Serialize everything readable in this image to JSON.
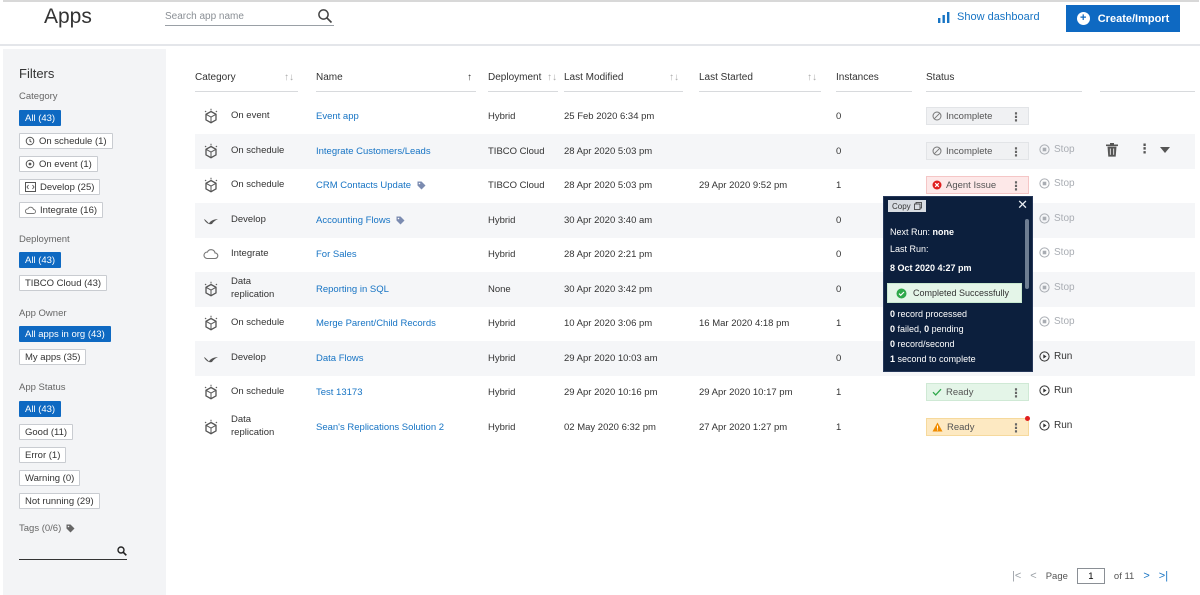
{
  "header": {
    "title": "Apps",
    "search_placeholder": "Search app name",
    "dashboard_link": "Show dashboard",
    "create_button": "Create/Import"
  },
  "sidebar": {
    "title": "Filters",
    "category_label": "Category",
    "category_chips": [
      "All (43)",
      "On schedule (1)",
      "On event (1)",
      "Develop (25)",
      "Integrate (16)"
    ],
    "deployment_label": "Deployment",
    "deployment_chips": [
      "All (43)",
      "TIBCO Cloud (43)"
    ],
    "owner_label": "App Owner",
    "owner_chips": [
      "All apps in org (43)",
      "My apps (35)"
    ],
    "status_label": "App Status",
    "status_chips": [
      "All (43)",
      "Good (11)",
      "Error (1)",
      "Warning (0)",
      "Not running (29)"
    ],
    "tags_label": "Tags (0/6)"
  },
  "table": {
    "columns": [
      "Category",
      "Name",
      "Deployment",
      "Last Modified",
      "Last Started",
      "Instances",
      "Status"
    ],
    "rows": [
      {
        "category": "On event",
        "name": "Event app",
        "deployment": "Hybrid",
        "modified": "25 Feb 2020 6:34 pm",
        "started": "",
        "instances": "0",
        "status": "Incomplete",
        "action": ""
      },
      {
        "category": "On schedule",
        "name": "Integrate Customers/Leads",
        "deployment": "TIBCO Cloud",
        "modified": "28 Apr 2020 5:03 pm",
        "started": "",
        "instances": "0",
        "status": "Incomplete",
        "action": "Stop"
      },
      {
        "category": "On schedule",
        "name": "CRM Contacts Update",
        "deployment": "TIBCO Cloud",
        "modified": "28 Apr 2020 5:03 pm",
        "started": "29 Apr 2020 9:52 pm",
        "instances": "1",
        "status": "Agent Issue",
        "action": "Stop"
      },
      {
        "category": "Develop",
        "name": "Accounting Flows",
        "deployment": "Hybrid",
        "modified": "30 Apr 2020 3:40 am",
        "started": "",
        "instances": "0",
        "status": "",
        "action": "Stop"
      },
      {
        "category": "Integrate",
        "name": "For Sales",
        "deployment": "Hybrid",
        "modified": "28 Apr 2020 2:21 pm",
        "started": "",
        "instances": "0",
        "status": "",
        "action": "Stop"
      },
      {
        "category": "Data replication",
        "category_line1": "Data",
        "category_line2": "replication",
        "name": "Reporting in SQL",
        "deployment": "None",
        "modified": "30 Apr 2020 3:42 pm",
        "started": "",
        "instances": "0",
        "status": "",
        "action": "Stop"
      },
      {
        "category": "On schedule",
        "name": "Merge Parent/Child Records",
        "deployment": "Hybrid",
        "modified": "10 Apr 2020 3:06 pm",
        "started": "16 Mar 2020 4:18 pm",
        "instances": "1",
        "status": "",
        "action": "Stop"
      },
      {
        "category": "Develop",
        "name": "Data Flows",
        "deployment": "Hybrid",
        "modified": "29 Apr 2020 10:03 am",
        "started": "",
        "instances": "0",
        "status": "",
        "action": "Run"
      },
      {
        "category": "On schedule",
        "name": "Test 13173",
        "deployment": "Hybrid",
        "modified": "29 Apr 2020 10:16 pm",
        "started": "29 Apr 2020 10:17 pm",
        "instances": "1",
        "status": "Ready",
        "action": "Run"
      },
      {
        "category": "Data replication",
        "category_line1": "Data",
        "category_line2": "replication",
        "name": "Sean's Replications Solution 2",
        "deployment": "Hybrid",
        "modified": "02 May 2020 6:32 pm",
        "started": "27 Apr 2020 1:27 pm",
        "instances": "1",
        "status": "Ready",
        "action": "Run"
      }
    ]
  },
  "popover": {
    "copy": "Copy",
    "next_run_label": "Next Run:",
    "next_run_value": "none",
    "last_run_label": "Last Run:",
    "last_run_value": "8 Oct 2020 4:27 pm",
    "success": "Completed Successfully",
    "processed_num": "0",
    "processed_text": "record processed",
    "failed_num": "0",
    "failed_text": "failed,",
    "pending_num": "0",
    "pending_text": "pending",
    "rate_num": "0",
    "rate_text": "record/second",
    "duration_num": "1",
    "duration_text": "second to complete"
  },
  "pagination": {
    "page_label": "Page",
    "current_page": "1",
    "of_label": "of 11"
  },
  "colors": {
    "accent": "#0e69c2",
    "link": "#1774c4",
    "popover_bg": "#0c1f3d",
    "error": "#e01e1e",
    "success": "#2ea84a",
    "warning": "#f08c00"
  }
}
